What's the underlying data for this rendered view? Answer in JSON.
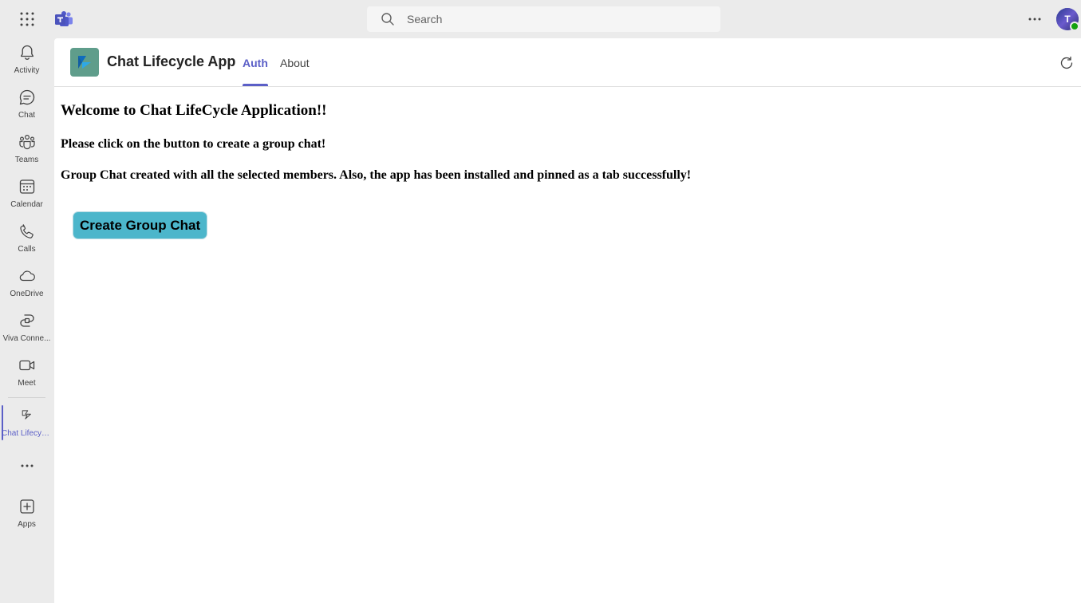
{
  "topbar": {
    "search_placeholder": "Search",
    "avatar_initial": "T"
  },
  "rail": {
    "items": [
      {
        "label": "Activity",
        "icon": "bell-icon"
      },
      {
        "label": "Chat",
        "icon": "chat-icon"
      },
      {
        "label": "Teams",
        "icon": "teams-icon"
      },
      {
        "label": "Calendar",
        "icon": "calendar-icon"
      },
      {
        "label": "Calls",
        "icon": "phone-icon"
      },
      {
        "label": "OneDrive",
        "icon": "cloud-icon"
      },
      {
        "label": "Viva Conne...",
        "icon": "viva-connections-icon"
      },
      {
        "label": "Meet",
        "icon": "video-icon"
      },
      {
        "label": "Chat Lifecyc...",
        "icon": "app-icon",
        "active": true
      },
      {
        "label": "Apps",
        "icon": "add-apps-icon"
      }
    ]
  },
  "app": {
    "title": "Chat Lifecycle App",
    "tabs": [
      {
        "label": "Auth",
        "active": true
      },
      {
        "label": "About",
        "active": false
      }
    ]
  },
  "page": {
    "heading": "Welcome to Chat LifeCycle Application!!",
    "instruction": "Please click on the button to create a group chat!",
    "status": "Group Chat created with all the selected members. Also, the app has been installed and pinned as a tab successfully!",
    "button_label": "Create Group Chat"
  },
  "colors": {
    "accent": "#5b5fc7",
    "button": "#4cb6cb",
    "app_icon_bg": "#5f9d8b",
    "presence": "#13a10e"
  }
}
